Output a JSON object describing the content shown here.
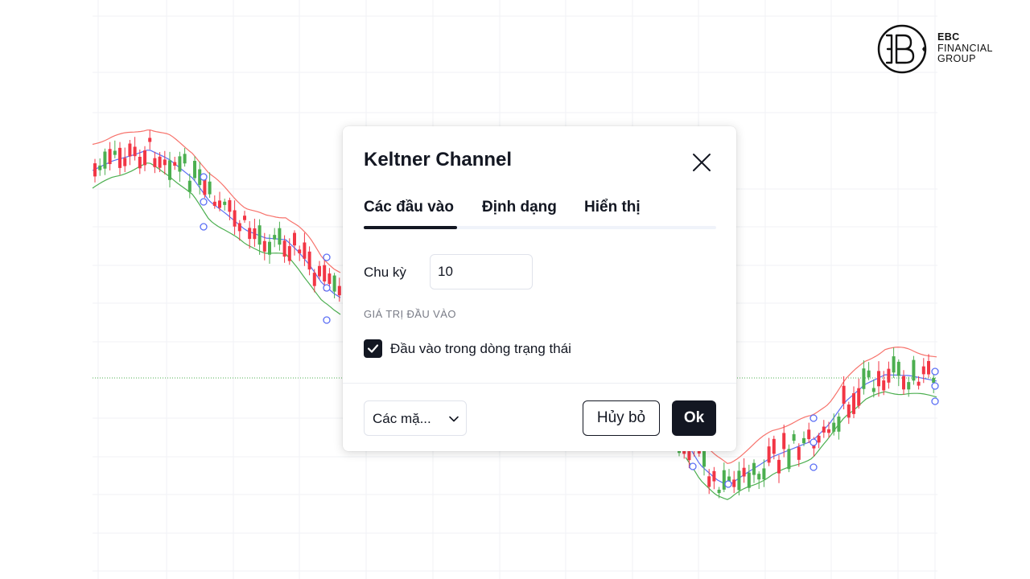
{
  "brand": {
    "logo_icon": "ebc-monogram-icon",
    "line1": "EBC",
    "line2": "FINANCIAL",
    "line3": "GROUP"
  },
  "dialog": {
    "title": "Keltner Channel",
    "close_icon": "close-icon",
    "tabs": [
      {
        "label": "Các đầu vào",
        "active": true
      },
      {
        "label": "Định dạng",
        "active": false
      },
      {
        "label": "Hiển thị",
        "active": false
      }
    ],
    "period_label": "Chu kỳ",
    "period_value": "10",
    "section_label": "GIÁ TRỊ ĐẦU VÀO",
    "checkbox_label": "Đầu vào trong dòng trạng thái",
    "checkbox_checked": true,
    "template_select_value": "Các mặ...",
    "cancel_label": "Hủy bỏ",
    "ok_label": "Ok"
  },
  "colors": {
    "candle_up": "#4caf50",
    "candle_down": "#f23645",
    "upper_band": "#f7726b",
    "middle_line": "#5b6ff5",
    "lower_band": "#4caf50",
    "price_line": "#4caf50",
    "dark_button": "#131722"
  }
}
